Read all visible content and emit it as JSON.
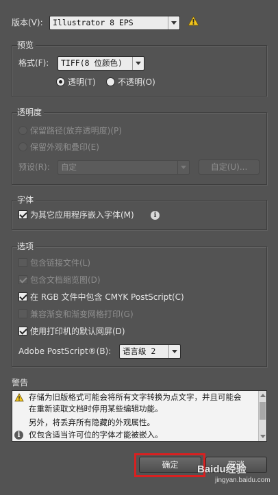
{
  "version": {
    "label": "版本(V):",
    "value": "Illustrator 8 EPS"
  },
  "preview": {
    "title": "预览",
    "format_label": "格式(F):",
    "format_value": "TIFF(8 位颜色)",
    "transparent_label": "透明(T)",
    "opaque_label": "不透明(O)"
  },
  "transparency": {
    "title": "透明度",
    "preserve_paths": "保留路径(放弃透明度)(P)",
    "preserve_appearance": "保留外观和叠印(E)",
    "preset_label": "预设(R):",
    "preset_value": "自定",
    "custom_button": "自定(U)..."
  },
  "fonts": {
    "title": "字体",
    "embed_label": "为其它应用程序嵌入字体(M)"
  },
  "options": {
    "title": "选项",
    "items": [
      {
        "label": "包含链接文件(L)",
        "checked": false,
        "enabled": false
      },
      {
        "label": "包含文档缩览图(D)",
        "checked": true,
        "enabled": false
      },
      {
        "label": "在 RGB 文件中包含 CMYK PostScript(C)",
        "checked": true,
        "enabled": true
      },
      {
        "label": "兼容渐变和渐变网格打印(G)",
        "checked": false,
        "enabled": false
      },
      {
        "label": "使用打印机的默认网屏(D)",
        "checked": true,
        "enabled": true
      }
    ],
    "postscript_label": "Adobe PostScript®(B):",
    "postscript_value": "语言级 2"
  },
  "warnings": {
    "title": "警告",
    "lines": [
      "存储为旧版格式可能会将所有文字转换为点文字，并且可能会",
      "在重新读取文档时停用某些编辑功能。",
      "另外，将丢弃所有隐藏的外观属性。",
      "仅包含适当许可位的字体才能被嵌入。"
    ]
  },
  "buttons": {
    "ok": "确定",
    "cancel": "取消"
  },
  "watermark": {
    "text": "Baidu经验",
    "url": "jingyan.baidu.com"
  },
  "colors": {
    "highlight": "#d92020",
    "warning": "#f2c51c"
  }
}
